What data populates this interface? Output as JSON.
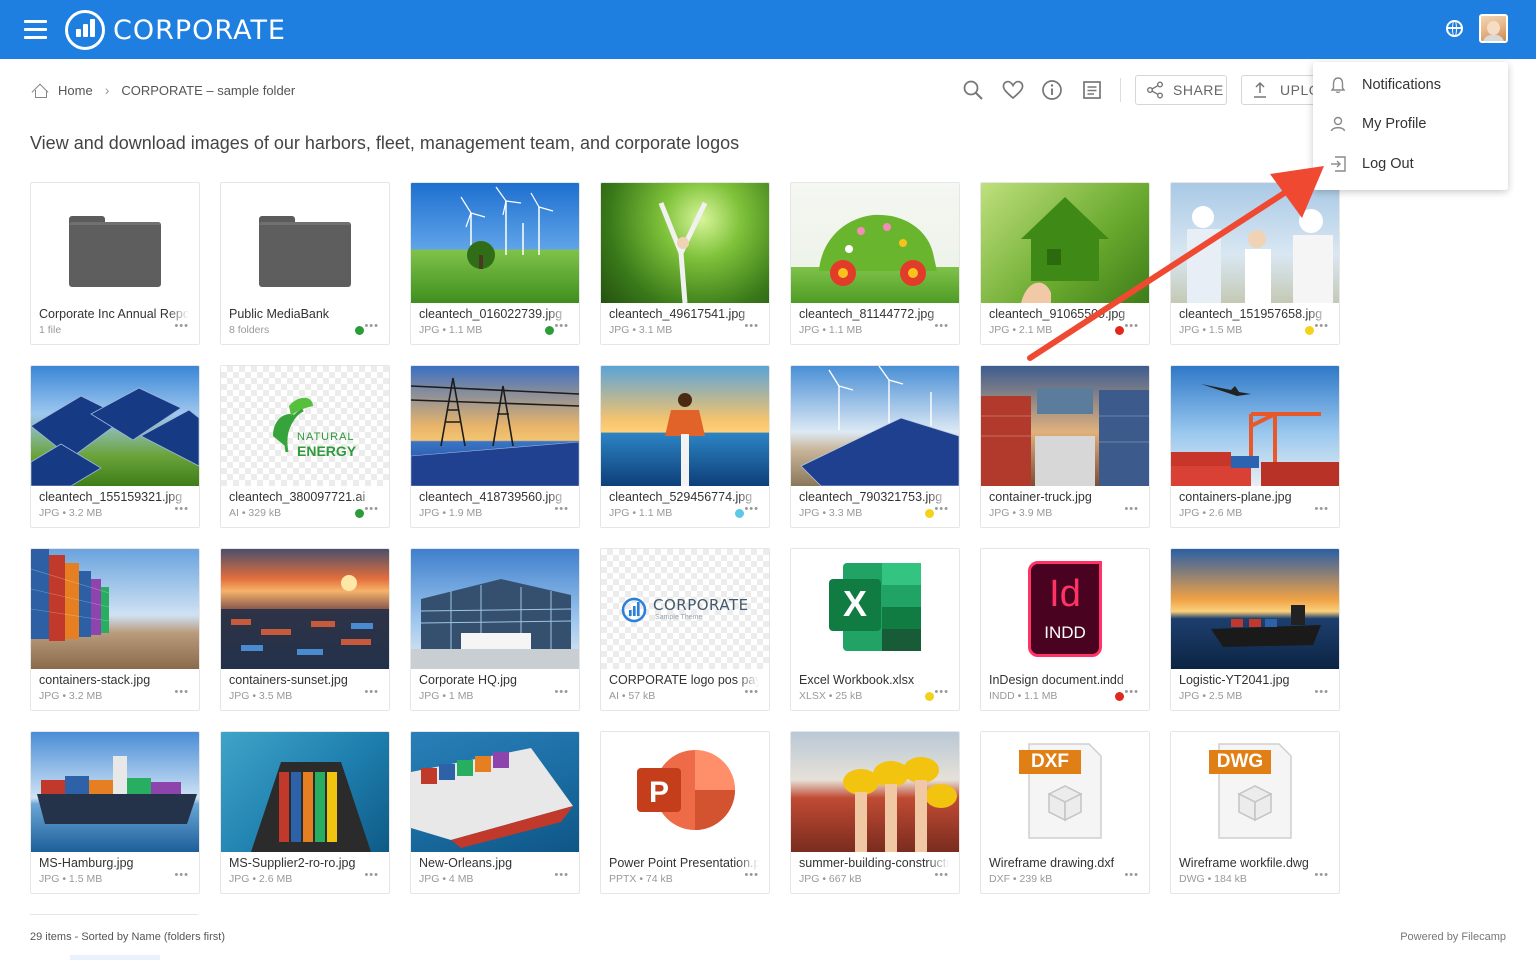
{
  "header": {
    "brand": "CORPORATE",
    "brand_color": "#1e7fe0",
    "menu_icon": "hamburger-icon",
    "language_icon": "globe-icon",
    "avatar_icon": "user-avatar"
  },
  "breadcrumb": {
    "home_label": "Home",
    "current_label": "CORPORATE – sample folder"
  },
  "toolbar": {
    "icons": [
      "search-icon",
      "heart-icon",
      "info-icon",
      "notes-icon"
    ],
    "share_label": "SHARE",
    "upload_label": "UPLOAD"
  },
  "page": {
    "heading": "View and download images of our harbors, fleet, management team, and corporate logos"
  },
  "user_menu": {
    "items": [
      {
        "label": "Notifications",
        "icon": "bell-icon"
      },
      {
        "label": "My Profile",
        "icon": "person-icon"
      },
      {
        "label": "Log Out",
        "icon": "logout-icon"
      }
    ]
  },
  "items": [
    {
      "name": "Corporate Inc Annual Report",
      "meta": "1 file",
      "status": "",
      "thumb": "folder"
    },
    {
      "name": "Public MediaBank",
      "meta": "8 folders",
      "status": "#2a9d3a",
      "thumb": "folder"
    },
    {
      "name": "cleantech_016022739.jpg",
      "meta": "JPG • 1.1 MB",
      "status": "#2a9d3a",
      "thumb": "wind-field"
    },
    {
      "name": "cleantech_49617541.jpg",
      "meta": "JPG • 3.1 MB",
      "status": "",
      "thumb": "forest"
    },
    {
      "name": "cleantech_81144772.jpg",
      "meta": "JPG • 1.1 MB",
      "status": "",
      "thumb": "flower-car"
    },
    {
      "name": "cleantech_91065509.jpg",
      "meta": "JPG • 2.1 MB",
      "status": "#e0281e",
      "thumb": "grass-house"
    },
    {
      "name": "cleantech_151957658.jpg",
      "meta": "JPG • 1.5 MB",
      "status": "#f2d21b",
      "thumb": "engineers"
    },
    {
      "name": "cleantech_155159321.jpg",
      "meta": "JPG • 3.2 MB",
      "status": "",
      "thumb": "solar-field"
    },
    {
      "name": "cleantech_380097721.ai",
      "meta": "AI • 329 kB",
      "status": "#2a9d3a",
      "thumb": "natural-energy"
    },
    {
      "name": "cleantech_418739560.jpg",
      "meta": "JPG • 1.9 MB",
      "status": "",
      "thumb": "pylons"
    },
    {
      "name": "cleantech_529456774.jpg",
      "meta": "JPG • 1.1 MB",
      "status": "#5bc8e6",
      "thumb": "sunset-man"
    },
    {
      "name": "cleantech_790321753.jpg",
      "meta": "JPG • 3.3 MB",
      "status": "#f2d21b",
      "thumb": "solar-wind"
    },
    {
      "name": "container-truck.jpg",
      "meta": "JPG • 3.9 MB",
      "status": "",
      "thumb": "container-truck"
    },
    {
      "name": "containers-plane.jpg",
      "meta": "JPG • 2.6 MB",
      "status": "",
      "thumb": "containers-plane"
    },
    {
      "name": "containers-stack.jpg",
      "meta": "JPG • 3.2 MB",
      "status": "",
      "thumb": "containers-stack"
    },
    {
      "name": "containers-sunset.jpg",
      "meta": "JPG • 3.5 MB",
      "status": "",
      "thumb": "containers-sunset"
    },
    {
      "name": "Corporate HQ.jpg",
      "meta": "JPG • 1 MB",
      "status": "",
      "thumb": "hq"
    },
    {
      "name": "CORPORATE logo pos payoff",
      "meta": "AI • 57 kB",
      "status": "",
      "thumb": "corp-logo",
      "logo_text": "CORPORATE",
      "logo_sub": "Sample Theme"
    },
    {
      "name": "Excel Workbook.xlsx",
      "meta": "XLSX • 25 kB",
      "status": "#f2d21b",
      "thumb": "excel"
    },
    {
      "name": "InDesign document.indd",
      "meta": "INDD • 1.1 MB",
      "status": "#e0281e",
      "thumb": "indesign",
      "badge": "Id",
      "badge_sub": "INDD"
    },
    {
      "name": "Logistic-YT2041.jpg",
      "meta": "JPG • 2.5 MB",
      "status": "",
      "thumb": "ship-sunset"
    },
    {
      "name": "MS-Hamburg.jpg",
      "meta": "JPG • 1.5 MB",
      "status": "",
      "thumb": "ship-hamburg"
    },
    {
      "name": "MS-Supplier2-ro-ro.jpg",
      "meta": "JPG • 2.6 MB",
      "status": "",
      "thumb": "ship-aerial"
    },
    {
      "name": "New-Orleans.jpg",
      "meta": "JPG • 4 MB",
      "status": "",
      "thumb": "ship-sea"
    },
    {
      "name": "Power Point Presentation.pptx",
      "meta": "PPTX • 74 kB",
      "status": "",
      "thumb": "powerpoint"
    },
    {
      "name": "summer-building-construction.jpg",
      "meta": "JPG • 667 kB",
      "status": "",
      "thumb": "helmets"
    },
    {
      "name": "Wireframe drawing.dxf",
      "meta": "DXF • 239 kB",
      "status": "",
      "thumb": "dxf",
      "badge": "DXF"
    },
    {
      "name": "Wireframe workfile.dwg",
      "meta": "DWG • 184 kB",
      "status": "",
      "thumb": "dwg",
      "badge": "DWG"
    }
  ],
  "footer": {
    "summary": "29 items - Sorted by Name (folders first)",
    "powered": "Powered by Filecamp"
  }
}
